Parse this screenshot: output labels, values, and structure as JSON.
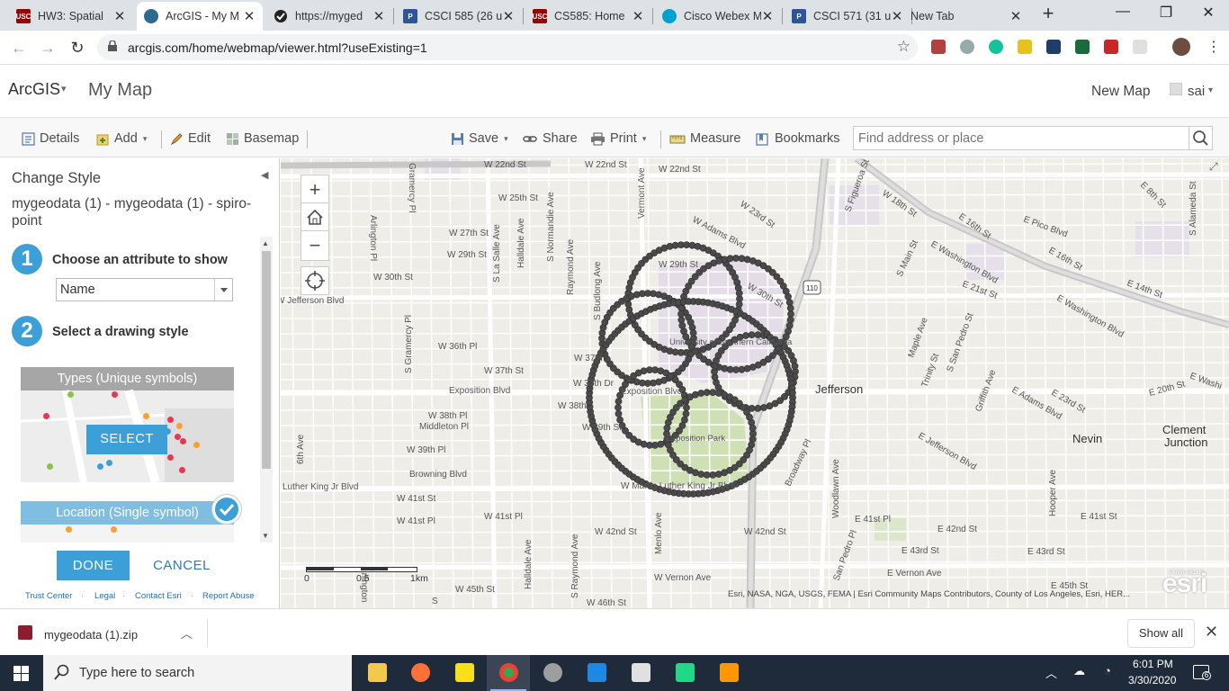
{
  "browser": {
    "tabs": [
      {
        "title": "HW3: Spatial",
        "favicon_color": "#990000",
        "favicon_text": "USC",
        "active": false
      },
      {
        "title": "ArcGIS - My M",
        "favicon_color": "#2d6a8f",
        "favicon_text": "",
        "active": true
      },
      {
        "title": "https://myged",
        "favicon_color": "#222222",
        "favicon_text": "",
        "active": false
      },
      {
        "title": "CSCI 585 (26 u",
        "favicon_color": "#2f5597",
        "favicon_text": "P",
        "active": false
      },
      {
        "title": "CS585: Home",
        "favicon_color": "#990000",
        "favicon_text": "USC",
        "active": false
      },
      {
        "title": "Cisco Webex M",
        "favicon_color": "#00a0d1",
        "favicon_text": "",
        "active": false
      },
      {
        "title": "CSCI 571 (31 u",
        "favicon_color": "#2f5597",
        "favicon_text": "P",
        "active": false
      },
      {
        "title": "New Tab",
        "favicon_color": "",
        "favicon_text": "",
        "active": false
      }
    ],
    "new_tab": "+",
    "window_controls": {
      "minimize": "—",
      "restore": "❐",
      "close": "✕"
    },
    "nav": {
      "back": "←",
      "forward": "→",
      "reload": "↻"
    },
    "url": "arcgis.com/home/webmap/viewer.html?useExisting=1",
    "bookmark_icon": "☆"
  },
  "arcgis": {
    "brand": "ArcGIS",
    "brand_caret": "▾",
    "map_title": "My Map",
    "new_map": "New Map",
    "user": "sai",
    "user_caret": "▾"
  },
  "toolbar": {
    "details": "Details",
    "add": "Add",
    "edit": "Edit",
    "basemap": "Basemap",
    "save": "Save",
    "share": "Share",
    "print": "Print",
    "measure": "Measure",
    "bookmarks": "Bookmarks",
    "search_placeholder": "Find address or place",
    "caret": "▾"
  },
  "panel": {
    "title": "Change Style",
    "collapse": "◀",
    "layer_name": "mygeodata (1) - mygeodata (1) - spiro-point",
    "step1": {
      "num": "1",
      "label": "Choose an attribute to show"
    },
    "attribute_value": "Name",
    "step2": {
      "num": "2",
      "label": "Select a drawing style"
    },
    "types_title": "Types (Unique symbols)",
    "select_button": "SELECT",
    "location_title": "Location (Single symbol)",
    "done_button": "DONE",
    "cancel_button": "CANCEL",
    "footer": [
      "Trust Center",
      "Legal",
      "Contact Esri",
      "Report Abuse"
    ],
    "scroll_up": "▲",
    "scroll_down": "▼",
    "accent": "#3d9fd8"
  },
  "map": {
    "zoom_in": "+",
    "zoom_out": "−",
    "scale_labels": [
      "0",
      "0.5",
      "1km"
    ],
    "attribution": "Esri, NASA, NGA, USGS, FEMA | Esri Community Maps Contributors, County of Los Angeles, Esri, HER...",
    "esri_logo": "esri",
    "powered_by": "POWERED BY",
    "expand_icon": "⤢",
    "labels": {
      "w22nd_a": "W 22nd St",
      "w22nd_b": "W 22nd St",
      "w22nd_c": "W 22nd St",
      "w25th": "W 25th St",
      "w27th": "W 27th St",
      "w29th_a": "W 29th St",
      "w29th_b": "W 29th St",
      "w30th_a": "W 30th St",
      "w30th_b": "W 30th St",
      "wjefferson": "W Jefferson Blvd",
      "w36th": "W 36th Pl",
      "w37th_st": "W 37th St",
      "w37th_a": "W 37th",
      "w37th_b": "W 37th Dr",
      "exposition_a": "Exposition Blvd",
      "exposition_b": "Exposition Blvd",
      "w38th_a": "W 38th",
      "w38th_pl": "W 38th Pl",
      "w39th_a": "W 39th St",
      "w39th_pl": "W 39th Pl",
      "middleton": "Middleton Pl",
      "browning": "Browning Blvd",
      "mlk_a": "Luther King Jr Blvd",
      "mlk_b": "W Martin Luther King Jr Blvd",
      "w41st_a": "W 41st St",
      "w41st_pl": "W 41st Pl",
      "w41st_b": "W 41st Pl",
      "w42nd_a": "W 42nd St",
      "w42nd_b": "W 42nd St",
      "wvernon": "W Vernon Ave",
      "w45th": "W 45th St",
      "w46th": "W 46th St",
      "usc": "University of Southern California",
      "expo_park": "Exposition Park",
      "jefferson": "Jefferson",
      "nevin": "Nevin",
      "clement": "Clement",
      "clement2": "Junction",
      "wadams": "W Adams Blvd",
      "w23rd": "W 23rd St",
      "sfigueroa": "S Figueroa St",
      "w18th": "W 18th St",
      "e16th": "E 16th St",
      "epico": "E Pico Blvd",
      "e8th": "E 8th St",
      "ewash": "E Washington Blvd",
      "e16th_b": "E 16th St",
      "e14th": "E 14th St",
      "smain": "S Main St",
      "e21st": "E 21st St",
      "e23rd": "E 23rd St",
      "ewash2": "E Washington Blvd",
      "eadams": "E Adams Blvd",
      "e20th": "E 20th St",
      "ejeff": "E Jefferson Blvd",
      "e41st": "E 41st Pl",
      "e42nd": "E 42nd St",
      "e43rd_a": "E 43rd St",
      "e43rd_b": "E 43rd St",
      "evernon": "E Vernon Ave",
      "e45th": "E 45th St",
      "e41st_b": "E 41st St",
      "ewashi": "E Washi",
      "broadway": "Broadway Pl",
      "woodlawn": "Woodlawn Ave",
      "sanpedro": "San Pedro Pl",
      "ssanpedro": "S San Pedro St",
      "maple": "Maple Ave",
      "trinity": "Trinity St",
      "griffith": "Griffith Ave",
      "hooper": "Hooper Ave",
      "salameda": "S Alameda St",
      "fwy110": "110",
      "arlington_a": "Arlington Pl",
      "arlington_b": "Arlington",
      "sgramercy_a": "S Gramercy Pl",
      "gramercy": "Gramercy Pl",
      "slasalle": "S La Salle Ave",
      "halldale_a": "Halldale Ave",
      "halldale_b": "Halldale Ave",
      "snormandie": "S Normandie Ave",
      "raymond_a": "Raymond Ave",
      "raymond_b": "S Raymond Ave",
      "sbudlong": "S Budlong Ave",
      "vermont": "Vermont Ave",
      "menlo": "Menlo Ave",
      "sixth": "6th Ave",
      "stockon": "S"
    }
  },
  "download": {
    "filename": "mygeodata (1).zip",
    "caret": "︿",
    "show_all": "Show all",
    "close": "✕"
  },
  "taskbar": {
    "search_text": "Type here to search",
    "time": "6:01 PM",
    "date": "3/30/2020",
    "tray_up": "︿",
    "notif_count": "6"
  }
}
